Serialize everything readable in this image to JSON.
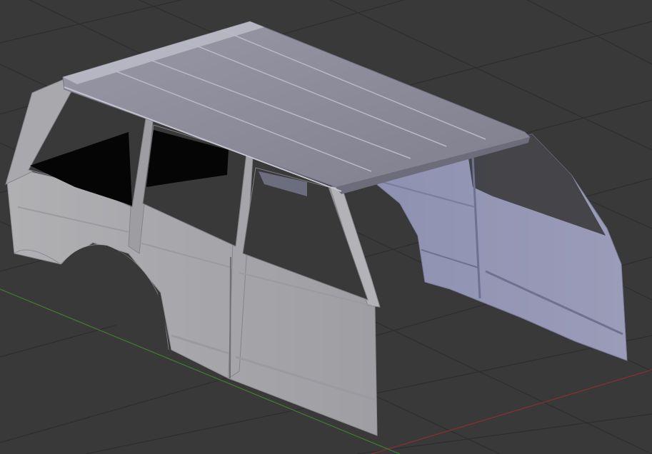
{
  "viewport": {
    "background": "#393939",
    "grid_color": "#2c2c2c",
    "axis_x_color": "#8b2f2f",
    "axis_y_color": "#3e7f2e"
  },
  "model": {
    "roof_color": "#8c8c9c",
    "body_color": "#a9a9b0",
    "far_side_color": "#8f92b3",
    "interior_color": "#050505"
  }
}
